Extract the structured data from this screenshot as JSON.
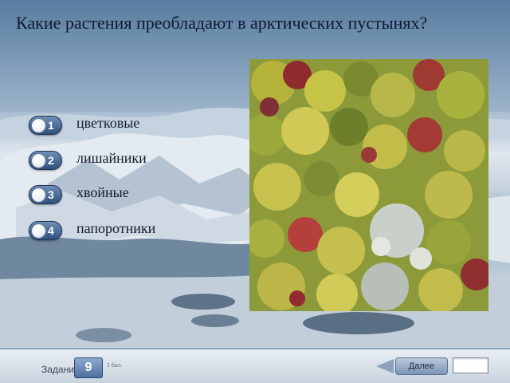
{
  "question": "Какие растения преобладают в арктических пустынях?",
  "options": [
    {
      "number": "1",
      "label": "цветковые"
    },
    {
      "number": "2",
      "label": "лишайники"
    },
    {
      "number": "3",
      "label": "хвойные"
    },
    {
      "number": "4",
      "label": "папоротники"
    }
  ],
  "footer": {
    "task_label": "Задание",
    "task_number": "9",
    "score_label": "1 бал.",
    "next_label": "Далее",
    "answer_value": ""
  },
  "images": {
    "background": "arctic-landscape-aerial",
    "photo": "tundra-moss-lichen-vegetation"
  },
  "colors": {
    "badge": "#3d5f8f",
    "question_text": "#0f1a33",
    "footer_bg": "#dbe2ea"
  }
}
